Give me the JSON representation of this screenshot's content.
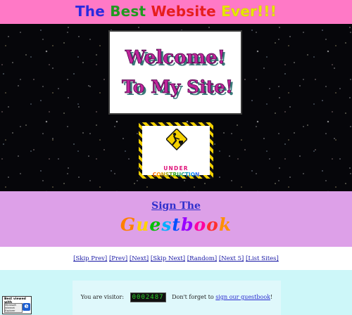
{
  "header": {
    "title_parts": [
      {
        "text": "The ",
        "color": "#2a2ae0"
      },
      {
        "text": "Best ",
        "color": "#1f9a1f"
      },
      {
        "text": "Website ",
        "color": "#e61e1e"
      },
      {
        "text": "Ever!!!",
        "color": "#e6e600"
      }
    ],
    "background": "#ff79c6"
  },
  "welcome_banner": {
    "line1": "Welcome!",
    "line2": "To My Site!"
  },
  "under_construction": {
    "line1": "UNDER",
    "line2": "CONSTRUCTION",
    "icon": "construction-worker-icon"
  },
  "guestbook": {
    "link_text": "Sign The",
    "word": [
      "G",
      "u",
      "e",
      "s",
      "t",
      "b",
      "o",
      "o",
      "k"
    ],
    "word_colors": [
      "#ff8000",
      "#ffd200",
      "#00c000",
      "#00b0ff",
      "#0050ff",
      "#9a00ff",
      "#ff00a0",
      "#ff3030",
      "#ff9000"
    ]
  },
  "webring": {
    "links": [
      "[Skip Prev]",
      "[Prev]",
      "[Next]",
      "[Skip Next]",
      "[Random]",
      "[Next 5]",
      "[List Sites]"
    ]
  },
  "footer": {
    "visitor_prefix": "You are visitor:",
    "counter": "0002487",
    "reminder_prefix": "Don't forget to",
    "reminder_link": "sign our guestbook",
    "reminder_suffix": "!",
    "best_viewed_title": "Best viewed with",
    "best_viewed_badge": "Microsoft Internet Explorer",
    "ie_letter": "e"
  }
}
